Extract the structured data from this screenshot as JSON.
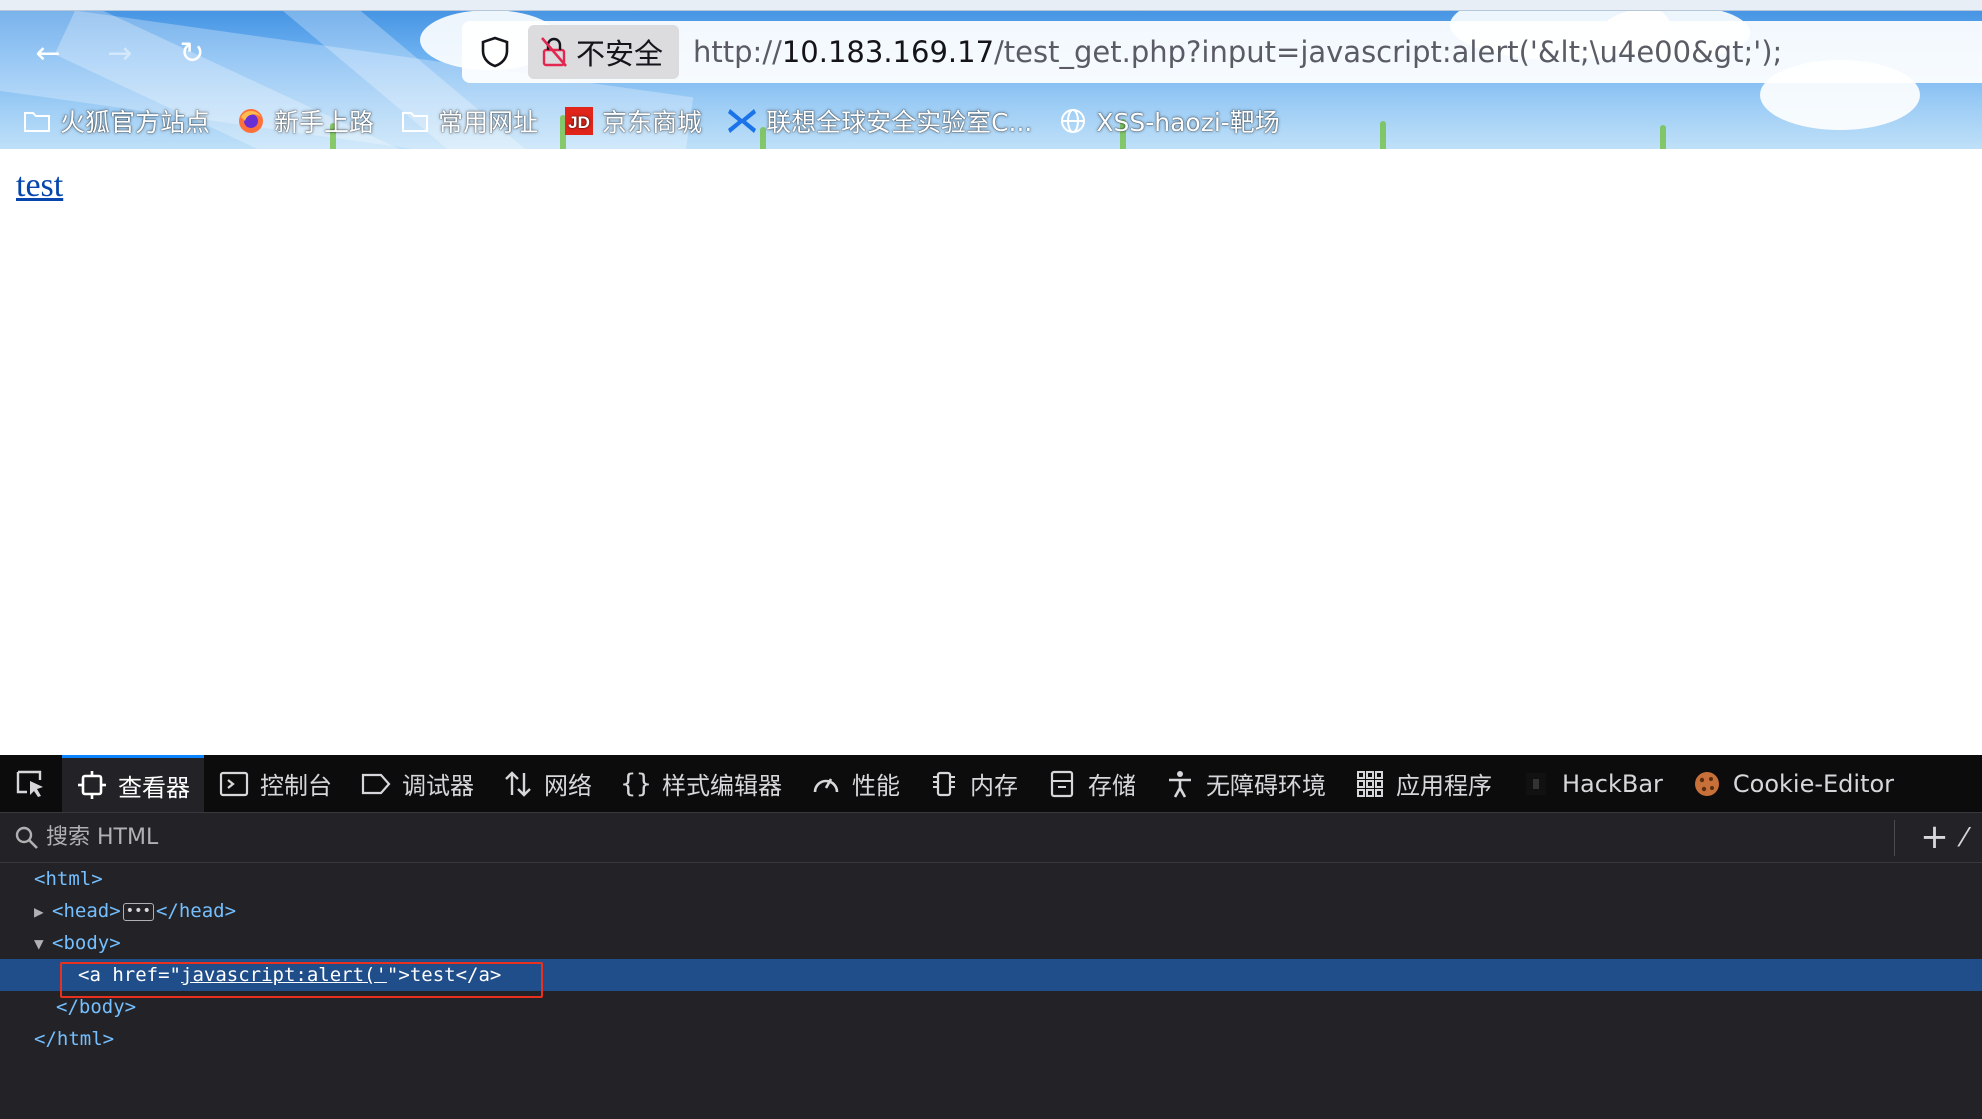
{
  "browser": {
    "nav": {
      "back": "←",
      "forward": "→",
      "reload": "↻"
    },
    "urlbar": {
      "insecure_label": "不安全",
      "url_scheme": "http://",
      "url_host": "10.183.169.17",
      "url_rest": "/test_get.php?input=javascript:alert('&lt;\\u4e00&gt;');"
    },
    "bookmarks": [
      {
        "label": "火狐官方站点",
        "icon": "folder-icon"
      },
      {
        "label": "新手上路",
        "icon": "firefox-icon"
      },
      {
        "label": "常用网址",
        "icon": "folder-icon"
      },
      {
        "label": "京东商城",
        "icon": "jd-icon"
      },
      {
        "label": "联想全球安全实验室C...",
        "icon": "lenovo-icon"
      },
      {
        "label": "XSS-haozi-靶场",
        "icon": "globe-icon"
      }
    ]
  },
  "page": {
    "link_text": "test"
  },
  "devtools": {
    "tabs": [
      {
        "label": "查看器",
        "icon": "inspector-icon",
        "active": true
      },
      {
        "label": "控制台",
        "icon": "console-icon"
      },
      {
        "label": "调试器",
        "icon": "debugger-icon"
      },
      {
        "label": "网络",
        "icon": "network-icon"
      },
      {
        "label": "样式编辑器",
        "icon": "style-editor-icon"
      },
      {
        "label": "性能",
        "icon": "performance-icon"
      },
      {
        "label": "内存",
        "icon": "memory-icon"
      },
      {
        "label": "存储",
        "icon": "storage-icon"
      },
      {
        "label": "无障碍环境",
        "icon": "accessibility-icon"
      },
      {
        "label": "应用程序",
        "icon": "application-icon"
      },
      {
        "label": "HackBar",
        "icon": "hackbar-icon"
      },
      {
        "label": "Cookie-Editor",
        "icon": "cookie-icon"
      }
    ],
    "search_placeholder": "搜索 HTML",
    "tree": {
      "html_open": "<html>",
      "head_open": "<head>",
      "head_close": "</head>",
      "body_open": "<body>",
      "a_open": "<a",
      "a_attr_name": "href=",
      "a_attr_quote_open": "\"",
      "a_attr_value": "javascript:alert('",
      "a_attr_quote_close": "\"",
      "a_open_end": ">",
      "a_text": "test",
      "a_close": "</a>",
      "body_close": "</body>",
      "html_close": "</html>"
    },
    "colors": {
      "highlight_border": "#e8321f",
      "selected_row": "#204e8a",
      "tag_color": "#75bfff"
    }
  }
}
